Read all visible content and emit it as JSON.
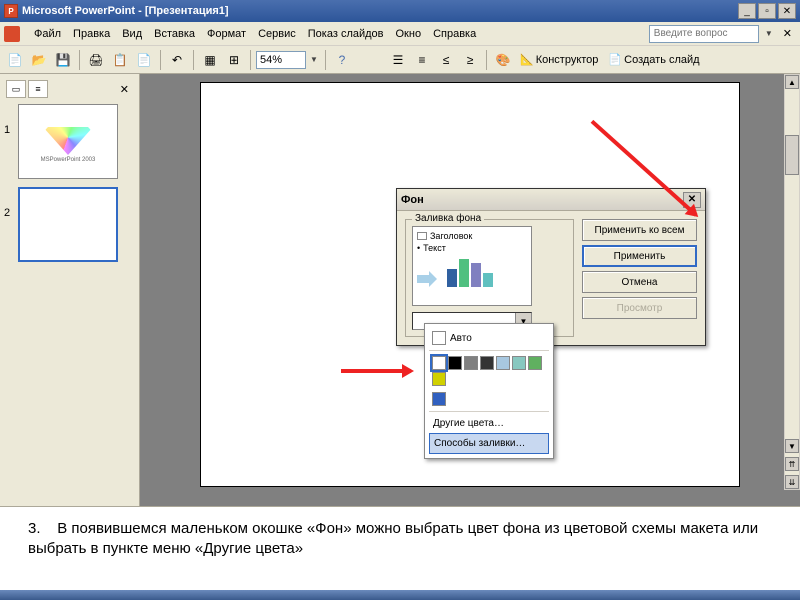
{
  "titlebar": {
    "app": "Microsoft PowerPoint",
    "doc": "[Презентация1]"
  },
  "menubar": {
    "items": [
      "Файл",
      "Правка",
      "Вид",
      "Вставка",
      "Формат",
      "Сервис",
      "Показ слайдов",
      "Окно",
      "Справка"
    ],
    "help_placeholder": "Введите вопрос"
  },
  "toolbar": {
    "zoom": "54%",
    "designer": "Конструктор",
    "new_slide": "Создать слайд"
  },
  "thumbnails": {
    "slides": [
      {
        "num": "1",
        "caption": "MSPowerPoint 2003"
      },
      {
        "num": "2",
        "caption": ""
      }
    ]
  },
  "bg_dialog": {
    "title": "Фон",
    "fill_label": "Заливка фона",
    "preview_title": "Заголовок",
    "preview_text": "Текст",
    "buttons": {
      "apply_all": "Применить ко всем",
      "apply": "Применить",
      "cancel": "Отмена",
      "preview": "Просмотр"
    }
  },
  "color_popup": {
    "auto": "Авто",
    "colors_row1": [
      "#ffffff",
      "#000000",
      "#808080",
      "#333333",
      "#a8c8e0",
      "#88c8c0",
      "#60b060",
      "#d0d000"
    ],
    "colors_row2": [
      "#3060c0"
    ],
    "more_colors": "Другие цвета…",
    "fill_methods": "Способы заливки…"
  },
  "footer": {
    "step": "3.",
    "text": "В появившемся маленьком окошке «Фон» можно выбрать цвет фона из цветовой схемы макета или выбрать в пункте меню «Другие цвета»"
  }
}
